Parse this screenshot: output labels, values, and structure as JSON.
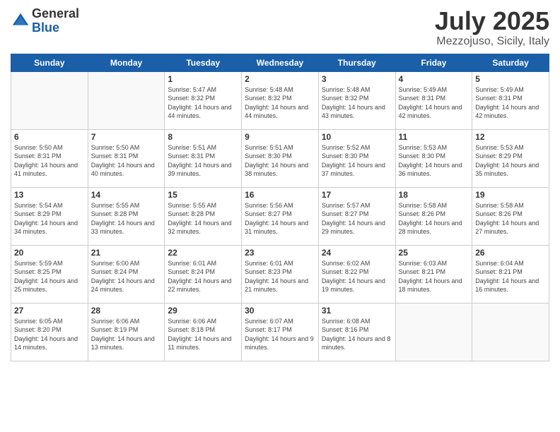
{
  "logo": {
    "general": "General",
    "blue": "Blue"
  },
  "header": {
    "month": "July 2025",
    "location": "Mezzojuso, Sicily, Italy"
  },
  "weekdays": [
    "Sunday",
    "Monday",
    "Tuesday",
    "Wednesday",
    "Thursday",
    "Friday",
    "Saturday"
  ],
  "weeks": [
    [
      {
        "day": "",
        "sunrise": "",
        "sunset": "",
        "daylight": ""
      },
      {
        "day": "",
        "sunrise": "",
        "sunset": "",
        "daylight": ""
      },
      {
        "day": "1",
        "sunrise": "Sunrise: 5:47 AM",
        "sunset": "Sunset: 8:32 PM",
        "daylight": "Daylight: 14 hours and 44 minutes."
      },
      {
        "day": "2",
        "sunrise": "Sunrise: 5:48 AM",
        "sunset": "Sunset: 8:32 PM",
        "daylight": "Daylight: 14 hours and 44 minutes."
      },
      {
        "day": "3",
        "sunrise": "Sunrise: 5:48 AM",
        "sunset": "Sunset: 8:32 PM",
        "daylight": "Daylight: 14 hours and 43 minutes."
      },
      {
        "day": "4",
        "sunrise": "Sunrise: 5:49 AM",
        "sunset": "Sunset: 8:31 PM",
        "daylight": "Daylight: 14 hours and 42 minutes."
      },
      {
        "day": "5",
        "sunrise": "Sunrise: 5:49 AM",
        "sunset": "Sunset: 8:31 PM",
        "daylight": "Daylight: 14 hours and 42 minutes."
      }
    ],
    [
      {
        "day": "6",
        "sunrise": "Sunrise: 5:50 AM",
        "sunset": "Sunset: 8:31 PM",
        "daylight": "Daylight: 14 hours and 41 minutes."
      },
      {
        "day": "7",
        "sunrise": "Sunrise: 5:50 AM",
        "sunset": "Sunset: 8:31 PM",
        "daylight": "Daylight: 14 hours and 40 minutes."
      },
      {
        "day": "8",
        "sunrise": "Sunrise: 5:51 AM",
        "sunset": "Sunset: 8:31 PM",
        "daylight": "Daylight: 14 hours and 39 minutes."
      },
      {
        "day": "9",
        "sunrise": "Sunrise: 5:51 AM",
        "sunset": "Sunset: 8:30 PM",
        "daylight": "Daylight: 14 hours and 38 minutes."
      },
      {
        "day": "10",
        "sunrise": "Sunrise: 5:52 AM",
        "sunset": "Sunset: 8:30 PM",
        "daylight": "Daylight: 14 hours and 37 minutes."
      },
      {
        "day": "11",
        "sunrise": "Sunrise: 5:53 AM",
        "sunset": "Sunset: 8:30 PM",
        "daylight": "Daylight: 14 hours and 36 minutes."
      },
      {
        "day": "12",
        "sunrise": "Sunrise: 5:53 AM",
        "sunset": "Sunset: 8:29 PM",
        "daylight": "Daylight: 14 hours and 35 minutes."
      }
    ],
    [
      {
        "day": "13",
        "sunrise": "Sunrise: 5:54 AM",
        "sunset": "Sunset: 8:29 PM",
        "daylight": "Daylight: 14 hours and 34 minutes."
      },
      {
        "day": "14",
        "sunrise": "Sunrise: 5:55 AM",
        "sunset": "Sunset: 8:28 PM",
        "daylight": "Daylight: 14 hours and 33 minutes."
      },
      {
        "day": "15",
        "sunrise": "Sunrise: 5:55 AM",
        "sunset": "Sunset: 8:28 PM",
        "daylight": "Daylight: 14 hours and 32 minutes."
      },
      {
        "day": "16",
        "sunrise": "Sunrise: 5:56 AM",
        "sunset": "Sunset: 8:27 PM",
        "daylight": "Daylight: 14 hours and 31 minutes."
      },
      {
        "day": "17",
        "sunrise": "Sunrise: 5:57 AM",
        "sunset": "Sunset: 8:27 PM",
        "daylight": "Daylight: 14 hours and 29 minutes."
      },
      {
        "day": "18",
        "sunrise": "Sunrise: 5:58 AM",
        "sunset": "Sunset: 8:26 PM",
        "daylight": "Daylight: 14 hours and 28 minutes."
      },
      {
        "day": "19",
        "sunrise": "Sunrise: 5:58 AM",
        "sunset": "Sunset: 8:26 PM",
        "daylight": "Daylight: 14 hours and 27 minutes."
      }
    ],
    [
      {
        "day": "20",
        "sunrise": "Sunrise: 5:59 AM",
        "sunset": "Sunset: 8:25 PM",
        "daylight": "Daylight: 14 hours and 25 minutes."
      },
      {
        "day": "21",
        "sunrise": "Sunrise: 6:00 AM",
        "sunset": "Sunset: 8:24 PM",
        "daylight": "Daylight: 14 hours and 24 minutes."
      },
      {
        "day": "22",
        "sunrise": "Sunrise: 6:01 AM",
        "sunset": "Sunset: 8:24 PM",
        "daylight": "Daylight: 14 hours and 22 minutes."
      },
      {
        "day": "23",
        "sunrise": "Sunrise: 6:01 AM",
        "sunset": "Sunset: 8:23 PM",
        "daylight": "Daylight: 14 hours and 21 minutes."
      },
      {
        "day": "24",
        "sunrise": "Sunrise: 6:02 AM",
        "sunset": "Sunset: 8:22 PM",
        "daylight": "Daylight: 14 hours and 19 minutes."
      },
      {
        "day": "25",
        "sunrise": "Sunrise: 6:03 AM",
        "sunset": "Sunset: 8:21 PM",
        "daylight": "Daylight: 14 hours and 18 minutes."
      },
      {
        "day": "26",
        "sunrise": "Sunrise: 6:04 AM",
        "sunset": "Sunset: 8:21 PM",
        "daylight": "Daylight: 14 hours and 16 minutes."
      }
    ],
    [
      {
        "day": "27",
        "sunrise": "Sunrise: 6:05 AM",
        "sunset": "Sunset: 8:20 PM",
        "daylight": "Daylight: 14 hours and 14 minutes."
      },
      {
        "day": "28",
        "sunrise": "Sunrise: 6:06 AM",
        "sunset": "Sunset: 8:19 PM",
        "daylight": "Daylight: 14 hours and 13 minutes."
      },
      {
        "day": "29",
        "sunrise": "Sunrise: 6:06 AM",
        "sunset": "Sunset: 8:18 PM",
        "daylight": "Daylight: 14 hours and 11 minutes."
      },
      {
        "day": "30",
        "sunrise": "Sunrise: 6:07 AM",
        "sunset": "Sunset: 8:17 PM",
        "daylight": "Daylight: 14 hours and 9 minutes."
      },
      {
        "day": "31",
        "sunrise": "Sunrise: 6:08 AM",
        "sunset": "Sunset: 8:16 PM",
        "daylight": "Daylight: 14 hours and 8 minutes."
      },
      {
        "day": "",
        "sunrise": "",
        "sunset": "",
        "daylight": ""
      },
      {
        "day": "",
        "sunrise": "",
        "sunset": "",
        "daylight": ""
      }
    ]
  ]
}
